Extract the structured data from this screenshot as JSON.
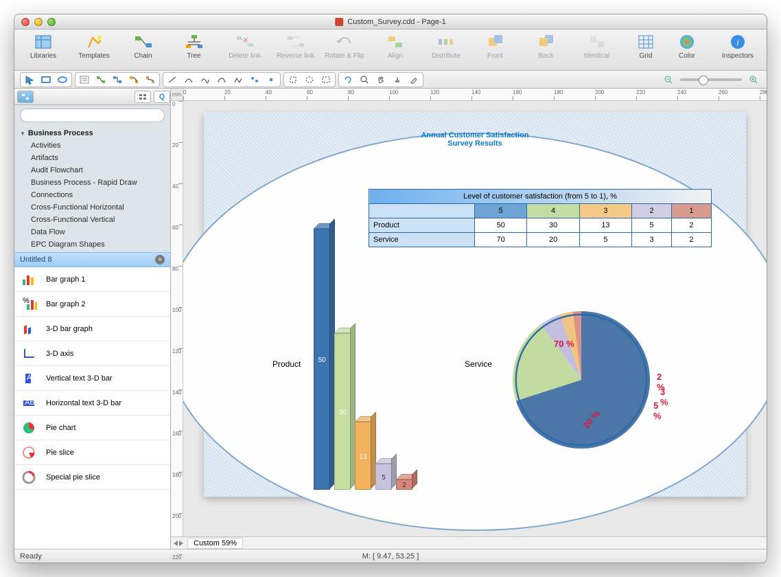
{
  "window": {
    "title": "Custom_Survey.cdd - Page-1"
  },
  "toolbar": {
    "libraries": "Libraries",
    "templates": "Templates",
    "chain": "Chain",
    "tree": "Tree",
    "delete_link": "Delete link",
    "reverse_link": "Reverse link",
    "rotate_flip": "Rotate & Flip",
    "align": "Align",
    "distribute": "Distribute",
    "front": "Front",
    "back": "Back",
    "identical": "Identical",
    "grid": "Grid",
    "color": "Color",
    "inspectors": "Inspectors"
  },
  "sidebar": {
    "search_placeholder": "",
    "group": "Business Process",
    "items": [
      "Activities",
      "Artifacts",
      "Audit Flowchart",
      "Business Process - Rapid Draw",
      "Connections",
      "Cross-Functional Horizontal",
      "Cross-Functional Vertical",
      "Data Flow",
      "EPC Diagram Shapes"
    ],
    "current_tab": "Untitled 8",
    "shapes": [
      "Bar graph   1",
      "Bar graph   2",
      "3-D bar graph",
      "3-D axis",
      "Vertical text 3-D bar",
      "Horizontal text 3-D bar",
      "Pie chart",
      "Pie slice",
      "Special pie slice"
    ]
  },
  "ruler_unit": "mm",
  "canvas": {
    "title_line1": "Annual Customer Satisfaction",
    "title_line2": "Survey Results",
    "table_header": "Level of customer satisfaction (from 5 to 1), %",
    "levels": [
      "5",
      "4",
      "3",
      "2",
      "1"
    ],
    "rows": [
      {
        "label": "Product",
        "vals": [
          "50",
          "30",
          "13",
          "5",
          "2"
        ]
      },
      {
        "label": "Service",
        "vals": [
          "70",
          "20",
          "5",
          "3",
          "2"
        ]
      }
    ],
    "bar_label": "Product",
    "pie_label": "Service"
  },
  "chart_data": [
    {
      "type": "bar",
      "title": "Product",
      "categories": [
        "5",
        "4",
        "3",
        "2",
        "1"
      ],
      "values": [
        50,
        30,
        13,
        5,
        2
      ],
      "colors": [
        "#3c74b0",
        "#c5dfa3",
        "#f2b25e",
        "#c7c3df",
        "#d8887b"
      ]
    },
    {
      "type": "pie",
      "title": "Service",
      "series": [
        {
          "name": "5",
          "value": 70,
          "label": "70 %",
          "color": "#4a76a8"
        },
        {
          "name": "4",
          "value": 20,
          "label": "20 %",
          "color": "#c2dba0"
        },
        {
          "name": "3",
          "value": 5,
          "label": "5 %",
          "color": "#c3bedd"
        },
        {
          "name": "2",
          "value": 3,
          "label": "3 %",
          "color": "#f2c480"
        },
        {
          "name": "1",
          "value": 2,
          "label": "2 %",
          "color": "#da9488"
        }
      ]
    }
  ],
  "footer": {
    "page_tab": "Custom 59%"
  },
  "status": {
    "left": "Ready",
    "center": "M: [ 9.47, 53.25 ]"
  }
}
